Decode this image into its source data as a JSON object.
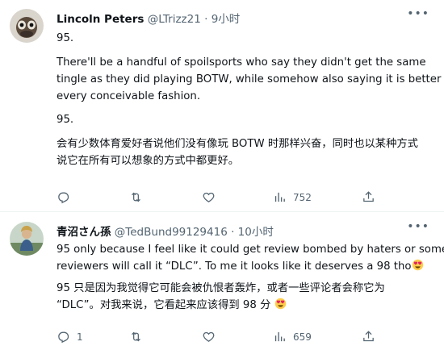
{
  "tweets": [
    {
      "name": "Lincoln Peters",
      "handle": "@LTrizz21",
      "sep": "·",
      "time": "9小时",
      "lines": [
        "95.",
        "",
        "There'll be a handful of spoilsports who say they didn't get the same",
        "tingle as they did playing BOTW, while somehow also saying it is better in",
        "every conceivable fashion.",
        "95.",
        "会有少数体育爱好者说他们没有像玩 BOTW 时那样兴奋，同时也以某种方式",
        "说它在所有可以想象的方式中都更好。"
      ],
      "stats": {
        "replies": "",
        "retweets": "",
        "likes": "",
        "views": "752"
      }
    },
    {
      "name": "青沼さん孫",
      "handle": "@TedBund99129416",
      "sep": "·",
      "time": "10小时",
      "lines": [
        "95 only because I feel like it could get review bombed by haters or some",
        "reviewers will call it “DLC”. To me it looks like it deserves a 98 tho",
        "95 只是因为我觉得它可能会被仇恨者轰炸，或者一些评论者会称它为",
        "“DLC”。对我来说，它看起来应该得到 98 分"
      ],
      "stats": {
        "replies": "1",
        "retweets": "",
        "likes": "",
        "views": "659"
      }
    }
  ],
  "icons": {
    "more": "more-icon",
    "reply": "reply-icon",
    "retweet": "retweet-icon",
    "like": "heart-icon",
    "views": "views-icon",
    "share": "share-icon",
    "emoji": "heart-eyes-emoji"
  },
  "colors": {
    "text": "#0f1419",
    "secondary": "#536471",
    "divider": "#eff3f4"
  }
}
